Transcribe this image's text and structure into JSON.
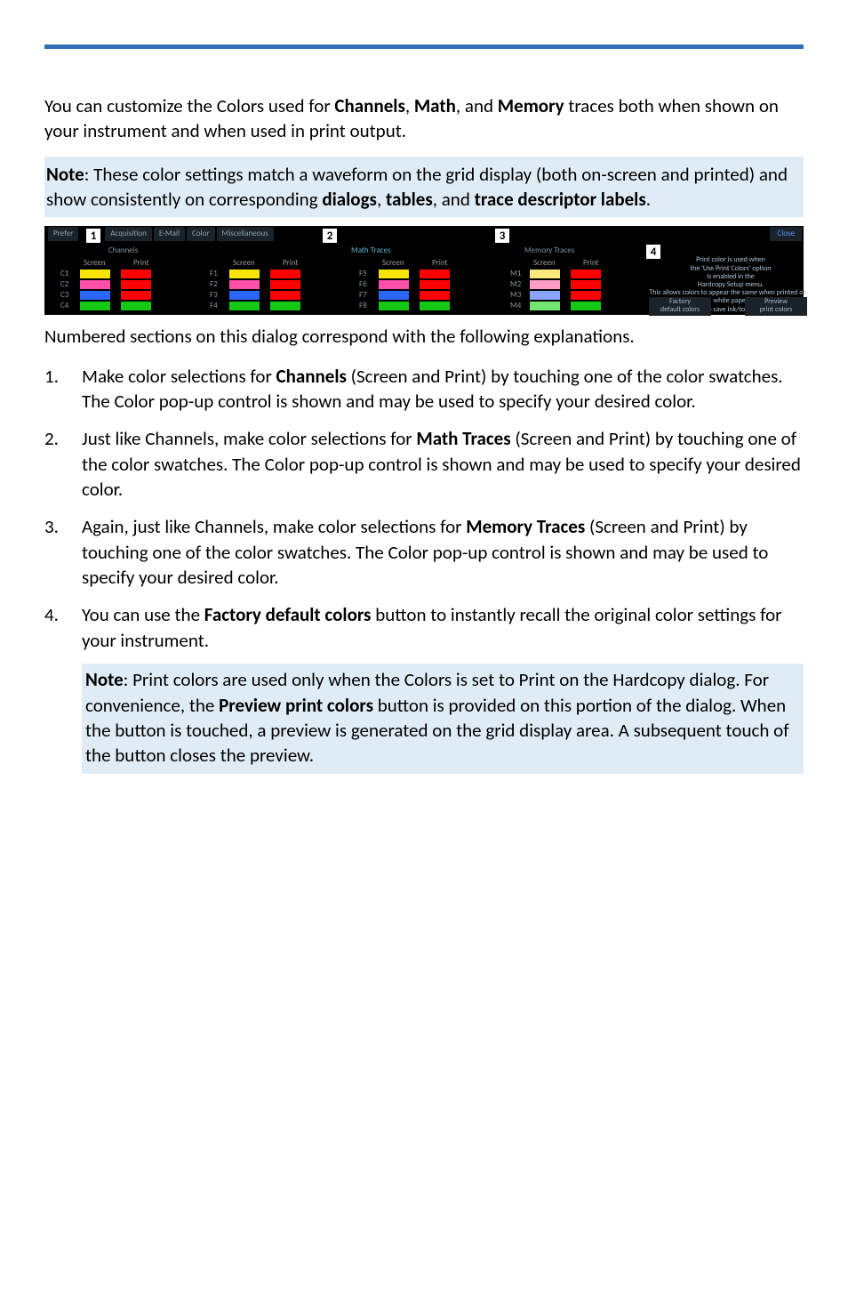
{
  "intro": {
    "pre": "You can customize the Colors used for ",
    "b1": "Channels",
    "mid1": ", ",
    "b2": "Math",
    "mid2": ", and ",
    "b3": "Memory",
    "post": " traces both when shown on your instrument and when used in print output."
  },
  "note1": {
    "label": "Note",
    "text1": ": These color settings match a waveform on the grid display (both on-screen and printed) and show consistently on corresponding ",
    "b1": "dialogs",
    "mid1": ", ",
    "b2": "tables",
    "mid2": ", and ",
    "b3": "trace descriptor labels",
    "post": "."
  },
  "dialog": {
    "tabs": [
      "Prefer",
      "Acquisition",
      "E-Mail",
      "Color",
      "Miscellaneous"
    ],
    "close": "Close",
    "groups": [
      "Channels",
      "Math Traces",
      "Memory Traces"
    ],
    "cols": [
      "Screen",
      "Print"
    ],
    "callouts": [
      "1",
      "2",
      "3",
      "4"
    ],
    "channels": {
      "rows": [
        "C1",
        "C2",
        "C3",
        "C4"
      ],
      "screen": [
        "#f7e400",
        "#ff4fa8",
        "#2a67ff",
        "#14c814"
      ],
      "print": [
        "#ff0000",
        "#ff0000",
        "#ff0000",
        "#14c814"
      ]
    },
    "math1": {
      "rows": [
        "F1",
        "F2",
        "F3",
        "F4"
      ],
      "screen": [
        "#f7e400",
        "#ff4fa8",
        "#2a67ff",
        "#14c814"
      ],
      "print": [
        "#ff0000",
        "#ff0000",
        "#ff0000",
        "#14c814"
      ]
    },
    "math2": {
      "rows": [
        "F5",
        "F6",
        "F7",
        "F8"
      ],
      "screen": [
        "#f7e400",
        "#ff4fa8",
        "#2a67ff",
        "#14c814"
      ],
      "print": [
        "#ff0000",
        "#ff0000",
        "#ff0000",
        "#14c814"
      ]
    },
    "memory": {
      "rows": [
        "M1",
        "M2",
        "M3",
        "M4"
      ],
      "screen": [
        "#f9e97a",
        "#ff9cc4",
        "#8aa4ff",
        "#72e472"
      ],
      "print": [
        "#ff0000",
        "#ff0000",
        "#ff0000",
        "#14c814"
      ]
    },
    "info_lines": [
      "Print color is used when",
      "the 'Use Print Colors' option",
      "is enabled in the",
      "Hardcopy Setup menu.",
      "This allows colors to appear the same when printed on",
      "white paper",
      "to save ink/toner."
    ],
    "btn_factory": "Factory\ndefault colors",
    "btn_preview": "Preview\nprint colors"
  },
  "postimg": "Numbered sections on this dialog correspond with the following explanations.",
  "items": {
    "n1": "1.",
    "n2": "2.",
    "n3": "3.",
    "n4": "4.",
    "i1a": "Make color selections for ",
    "i1b": "Channels",
    "i1c": " (Screen and Print) by touching one of the color swatches. The Color pop-up control is shown and may be used to specify your desired color.",
    "i2a": "Just like Channels, make color selections for ",
    "i2b": "Math Traces",
    "i2c": " (Screen and Print) by touching one of the color swatches. The Color pop-up control is shown and may be used to specify your desired color.",
    "i3a": "Again, just like Channels, make color selections for ",
    "i3b": "Memory Traces",
    "i3c": " (Screen and Print) by touching one of the color swatches. The Color pop-up control is shown and may be used to specify your desired color.",
    "i4a": "You can use the ",
    "i4b": "Factory default colors",
    "i4c": " button to instantly recall the original color settings for your instrument."
  },
  "note2": {
    "label": "Note",
    "t1": ": Print colors are used only when the Colors is set to Print on the Hardcopy dialog. For convenience, the ",
    "b1": "Preview print colors",
    "t2": " button is provided on this portion of the dialog. When the button is touched, a preview is generated on the grid display area. A subsequent touch of the button closes the preview."
  }
}
